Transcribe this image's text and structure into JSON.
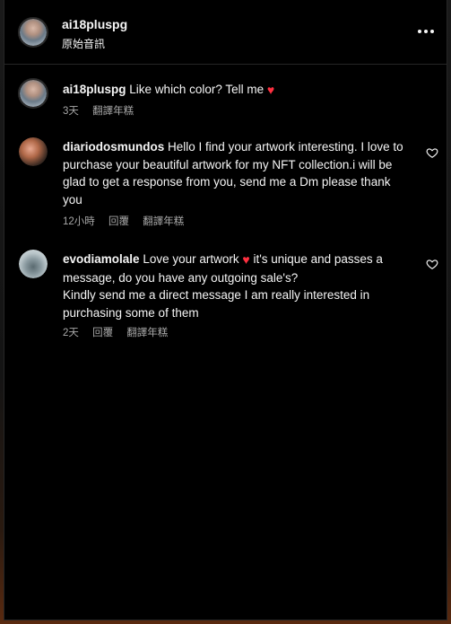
{
  "header": {
    "username": "ai18pluspg",
    "subtitle": "原始音訊",
    "more_icon": "more-horizontal-icon"
  },
  "comments": [
    {
      "username": "ai18pluspg",
      "text": "Like which color? Tell me",
      "emoji": "♥",
      "time": "3天",
      "reply_label": "",
      "translate_label": "翻譯年糕",
      "has_like": false
    },
    {
      "username": "diariodosmundos",
      "text": "Hello I find your artwork interesting. I love to purchase your beautiful artwork for my NFT collection.i will be glad to get a response from you, send me a Dm please thank you",
      "time": "12小時",
      "reply_label": "回覆",
      "translate_label": "翻譯年糕",
      "has_like": true
    },
    {
      "username": "evodiamolale",
      "text_before_emoji": "Love your artwork",
      "emoji": "♥",
      "text_after_emoji": "it's unique and passes a message, do you have any outgoing sale's?",
      "text_line2": "Kindly send me a direct message I am really interested in purchasing some of them",
      "time": "2天",
      "reply_label": "回覆",
      "translate_label": "翻譯年糕",
      "has_like": true
    }
  ],
  "colors": {
    "background": "#000000",
    "text": "#f5f5f5",
    "secondary_text": "#a8a8a8",
    "heart": "#ff3040",
    "divider": "#262626"
  }
}
